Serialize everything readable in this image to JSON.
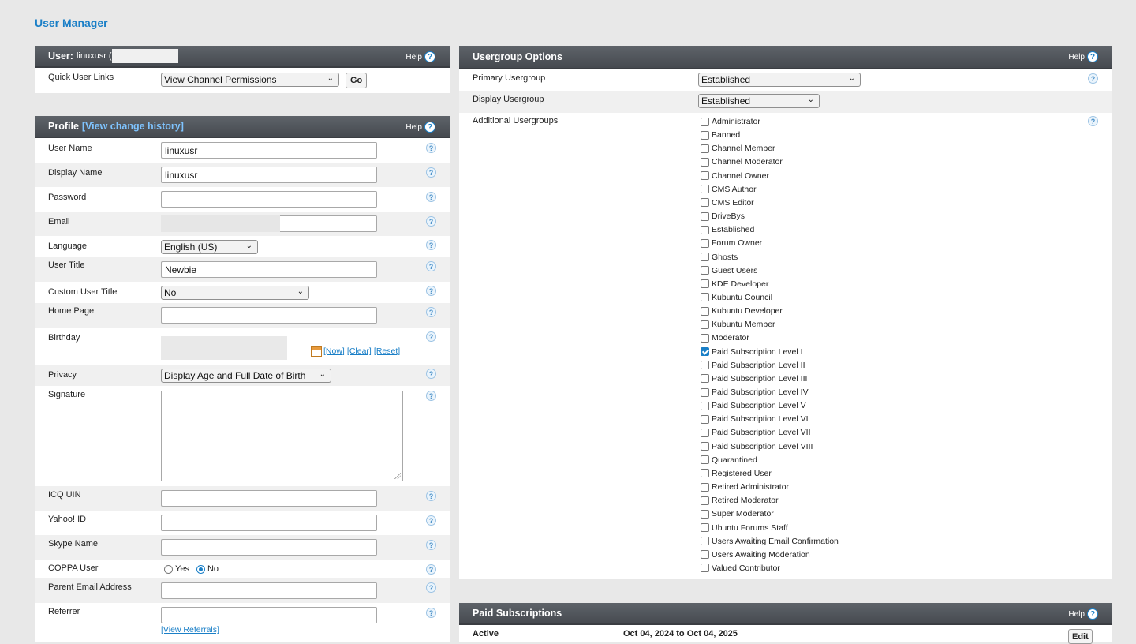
{
  "page": {
    "title": "User Manager"
  },
  "user_panel": {
    "title_prefix": "User:",
    "username": "linuxusr (",
    "help_label": "Help",
    "quick_links_label": "Quick User Links",
    "quick_links_selected": "View Channel Permissions",
    "go_label": "Go"
  },
  "profile": {
    "title": "Profile",
    "history_link": "[View change history]",
    "help_label": "Help",
    "fields": {
      "user_name": {
        "label": "User Name",
        "value": "linuxusr"
      },
      "display_name": {
        "label": "Display Name",
        "value": "linuxusr"
      },
      "password": {
        "label": "Password",
        "value": ""
      },
      "email": {
        "label": "Email",
        "value": ""
      },
      "language": {
        "label": "Language",
        "value": "English (US)"
      },
      "user_title": {
        "label": "User Title",
        "value": "Newbie"
      },
      "custom_user_title": {
        "label": "Custom User Title",
        "value": "No"
      },
      "home_page": {
        "label": "Home Page",
        "value": ""
      },
      "birthday": {
        "label": "Birthday",
        "now": "[Now]",
        "clear": "[Clear]",
        "reset": "[Reset]"
      },
      "privacy": {
        "label": "Privacy",
        "value": "Display Age and Full Date of Birth"
      },
      "signature": {
        "label": "Signature",
        "value": ""
      },
      "icq": {
        "label": "ICQ UIN",
        "value": ""
      },
      "yahoo": {
        "label": "Yahoo! ID",
        "value": ""
      },
      "skype": {
        "label": "Skype Name",
        "value": ""
      },
      "coppa": {
        "label": "COPPA User",
        "yes": "Yes",
        "no": "No"
      },
      "parent_email": {
        "label": "Parent Email Address",
        "value": ""
      },
      "referrer": {
        "label": "Referrer",
        "value": "",
        "referrals_link": "[View Referrals]"
      }
    }
  },
  "usergroup": {
    "title": "Usergroup Options",
    "help_label": "Help",
    "primary_label": "Primary Usergroup",
    "primary_value": "Established",
    "display_label": "Display Usergroup",
    "display_value": "Established",
    "additional_label": "Additional Usergroups",
    "groups": [
      {
        "name": "Administrator",
        "checked": false
      },
      {
        "name": "Banned",
        "checked": false
      },
      {
        "name": "Channel Member",
        "checked": false
      },
      {
        "name": "Channel Moderator",
        "checked": false
      },
      {
        "name": "Channel Owner",
        "checked": false
      },
      {
        "name": "CMS Author",
        "checked": false
      },
      {
        "name": "CMS Editor",
        "checked": false
      },
      {
        "name": "DriveBys",
        "checked": false
      },
      {
        "name": "Established",
        "checked": false
      },
      {
        "name": "Forum Owner",
        "checked": false
      },
      {
        "name": "Ghosts",
        "checked": false
      },
      {
        "name": "Guest Users",
        "checked": false
      },
      {
        "name": "KDE Developer",
        "checked": false
      },
      {
        "name": "Kubuntu Council",
        "checked": false
      },
      {
        "name": "Kubuntu Developer",
        "checked": false
      },
      {
        "name": "Kubuntu Member",
        "checked": false
      },
      {
        "name": "Moderator",
        "checked": false
      },
      {
        "name": "Paid Subscription Level I",
        "checked": true
      },
      {
        "name": "Paid Subscription Level II",
        "checked": false
      },
      {
        "name": "Paid Subscription Level III",
        "checked": false
      },
      {
        "name": "Paid Subscription Level IV",
        "checked": false
      },
      {
        "name": "Paid Subscription Level V",
        "checked": false
      },
      {
        "name": "Paid Subscription Level VI",
        "checked": false
      },
      {
        "name": "Paid Subscription Level VII",
        "checked": false
      },
      {
        "name": "Paid Subscription Level VIII",
        "checked": false
      },
      {
        "name": "Quarantined",
        "checked": false
      },
      {
        "name": "Registered User",
        "checked": false
      },
      {
        "name": "Retired Administrator",
        "checked": false
      },
      {
        "name": "Retired Moderator",
        "checked": false
      },
      {
        "name": "Super Moderator",
        "checked": false
      },
      {
        "name": "Ubuntu Forums Staff",
        "checked": false
      },
      {
        "name": "Users Awaiting Email Confirmation",
        "checked": false
      },
      {
        "name": "Users Awaiting Moderation",
        "checked": false
      },
      {
        "name": "Valued Contributor",
        "checked": false
      }
    ]
  },
  "subscriptions": {
    "title": "Paid Subscriptions",
    "help_label": "Help",
    "status": "Active",
    "range": "Oct 04, 2024 to Oct 04, 2025",
    "edit_label": "Edit"
  },
  "help_glyph": "?"
}
